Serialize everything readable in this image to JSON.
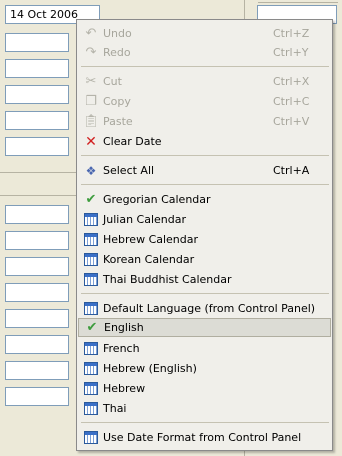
{
  "date_field": {
    "value": "14 Oct 2006"
  },
  "menu": {
    "undo": {
      "label": "Undo",
      "shortcut": "Ctrl+Z",
      "icon": "undo-icon"
    },
    "redo": {
      "label": "Redo",
      "shortcut": "Ctrl+Y",
      "icon": "redo-icon"
    },
    "cut": {
      "label": "Cut",
      "shortcut": "Ctrl+X",
      "icon": "scissors-icon"
    },
    "copy": {
      "label": "Copy",
      "shortcut": "Ctrl+C",
      "icon": "copy-icon"
    },
    "paste": {
      "label": "Paste",
      "shortcut": "Ctrl+V",
      "icon": "paste-icon"
    },
    "clear_date": {
      "label": "Clear Date",
      "icon": "red-x-icon"
    },
    "select_all": {
      "label": "Select All",
      "shortcut": "Ctrl+A",
      "icon": "select-all-icon"
    },
    "calendars": [
      {
        "label": "Gregorian Calendar",
        "checked": true
      },
      {
        "label": "Julian Calendar",
        "checked": false
      },
      {
        "label": "Hebrew Calendar",
        "checked": false
      },
      {
        "label": "Korean Calendar",
        "checked": false
      },
      {
        "label": "Thai Buddhist Calendar",
        "checked": false
      }
    ],
    "languages": [
      {
        "label": "Default Language (from Control Panel)",
        "checked": false
      },
      {
        "label": "English",
        "checked": true
      },
      {
        "label": "French",
        "checked": false
      },
      {
        "label": "Hebrew (English)",
        "checked": false
      },
      {
        "label": "Hebrew",
        "checked": false
      },
      {
        "label": "Thai",
        "checked": false
      }
    ],
    "use_date_format": {
      "label": "Use Date Format from Control Panel"
    }
  },
  "colors": {
    "accent_check": "#3d9c3d",
    "clear_x": "#d12020",
    "menu_bg": "#f0efea",
    "window_bg": "#ece9d8"
  }
}
